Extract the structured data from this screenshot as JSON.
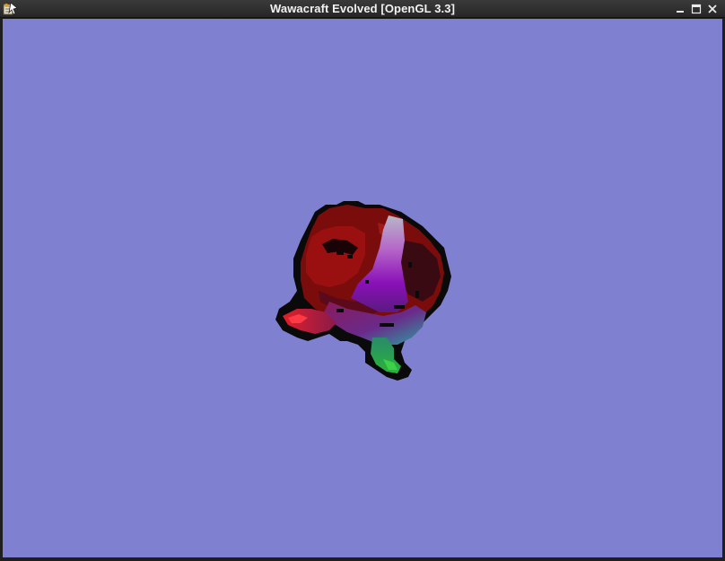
{
  "window": {
    "title": "Wawacraft Evolved [OpenGL 3.3]",
    "icons": {
      "app": "app-icon",
      "minimize": "minimize-icon",
      "maximize": "maximize-icon",
      "close": "close-icon"
    }
  },
  "scene": {
    "background_color": "#8080d0",
    "object": "voxel-creature"
  }
}
